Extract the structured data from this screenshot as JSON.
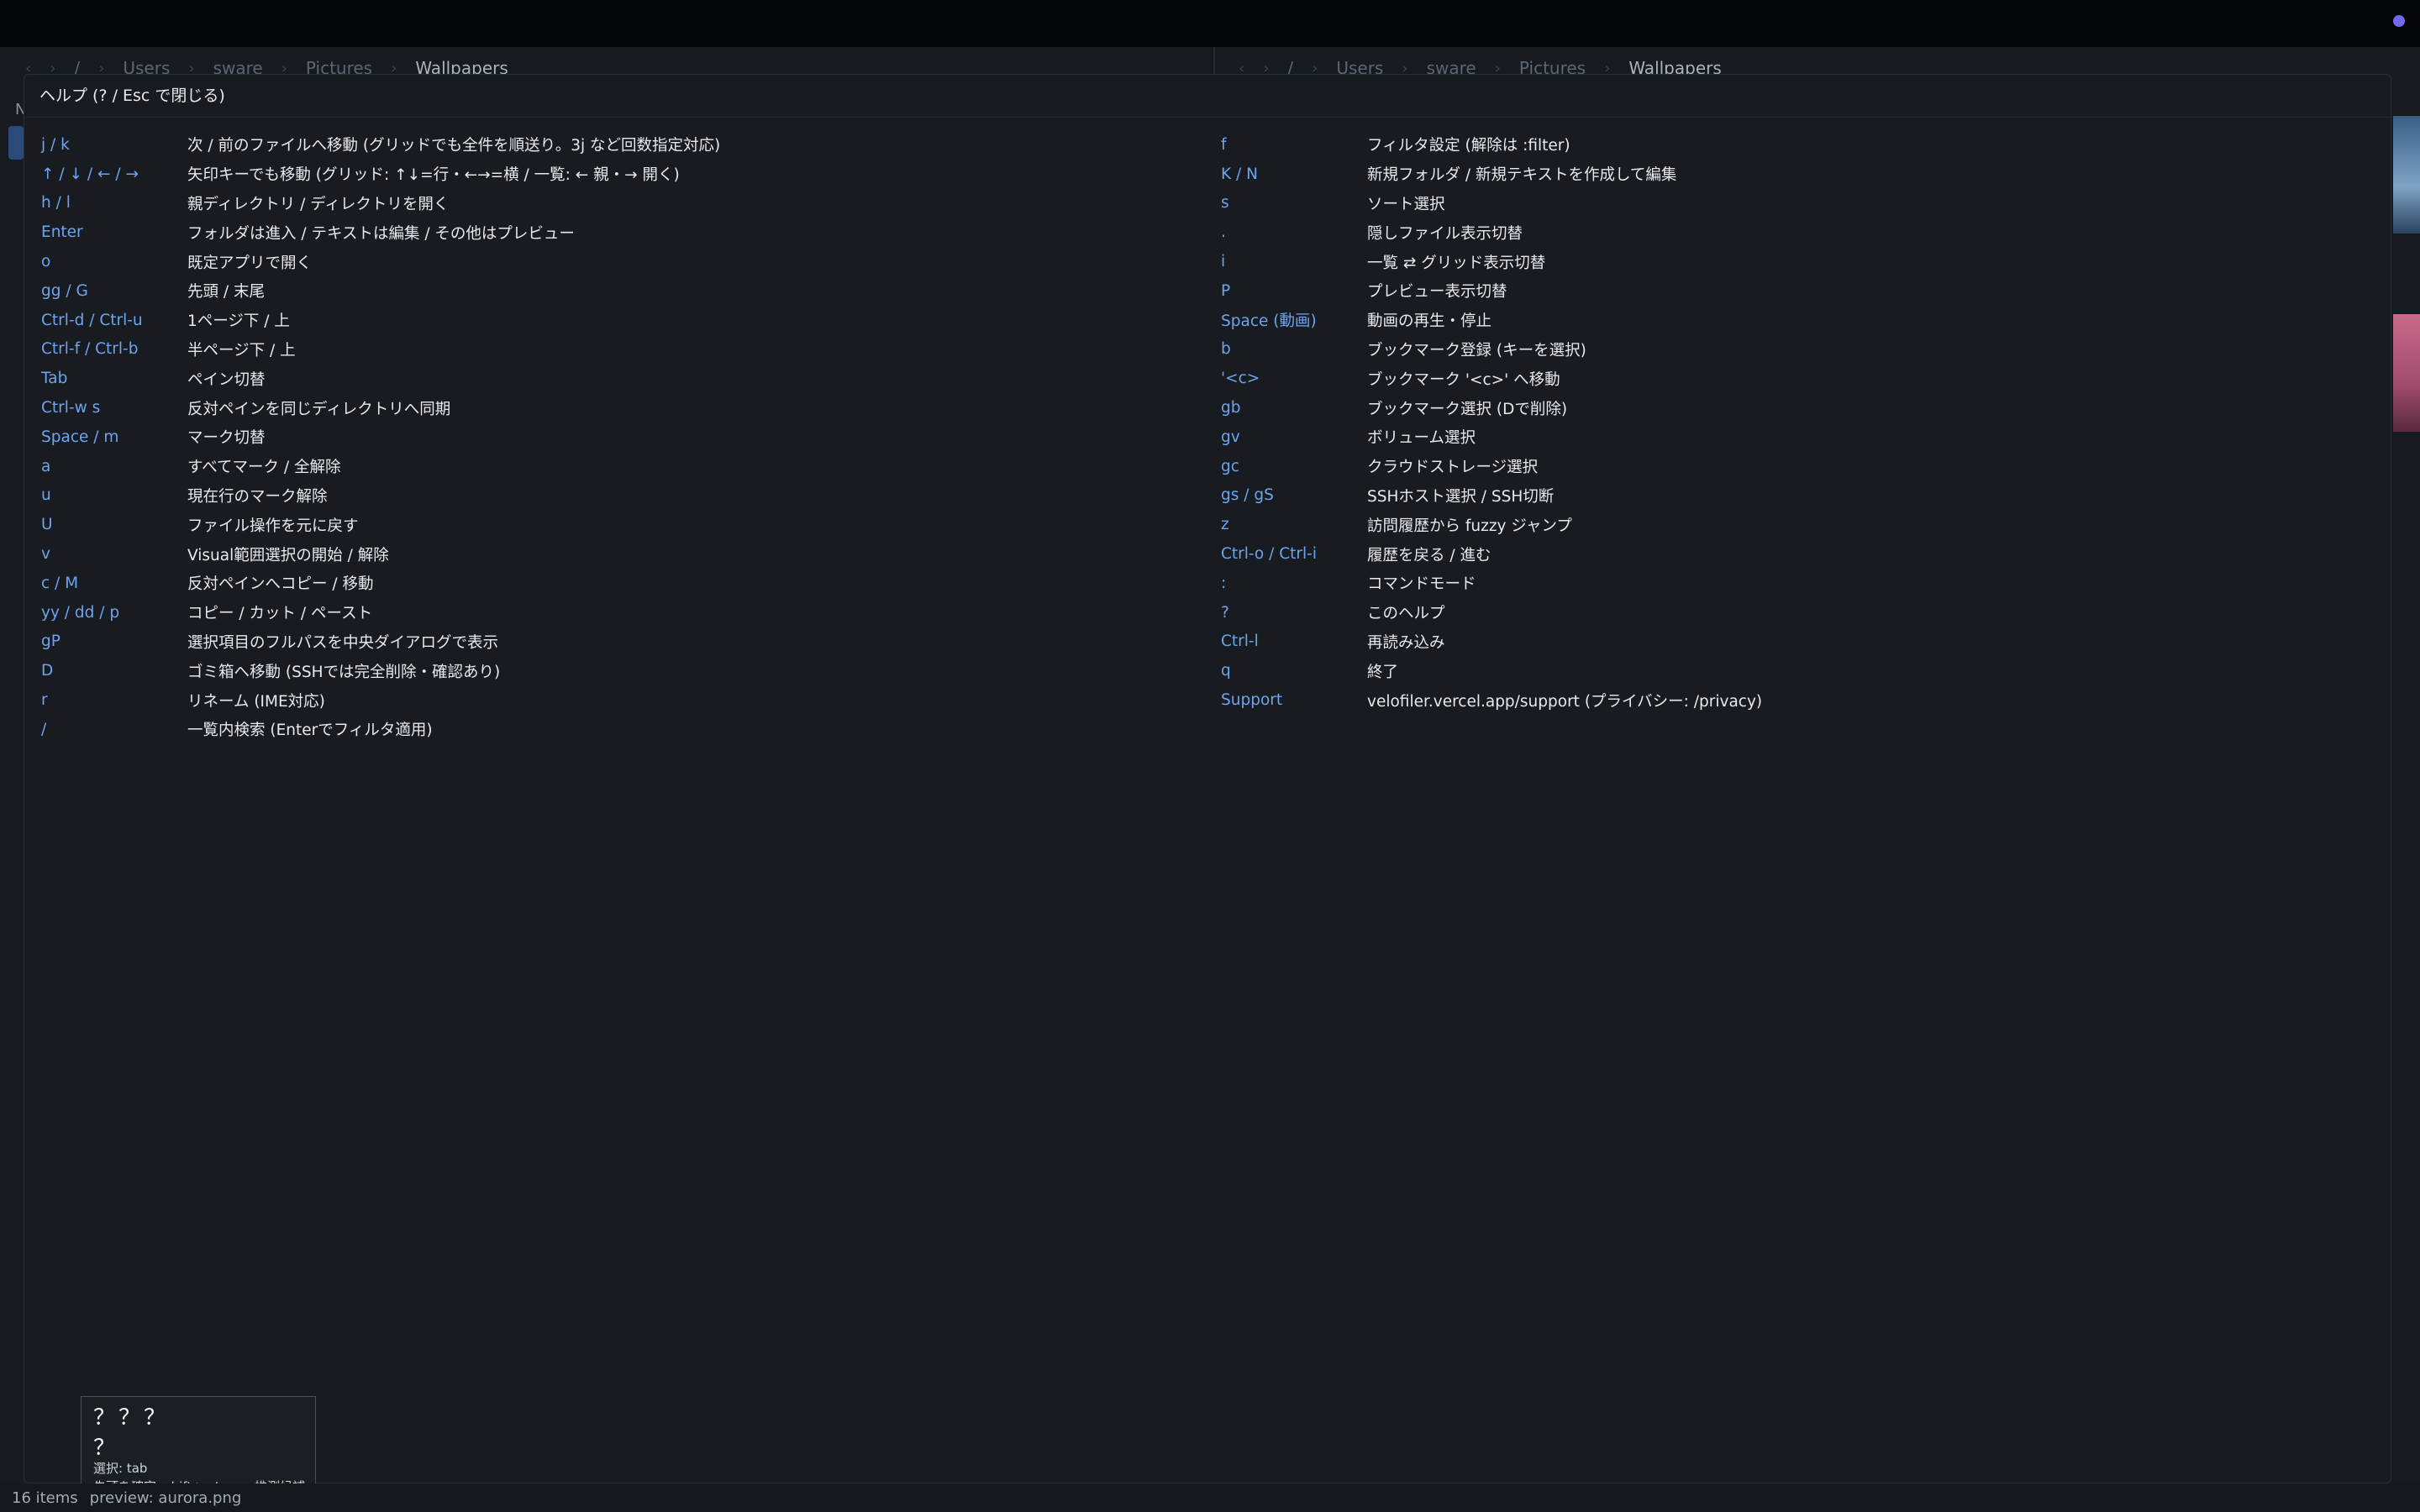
{
  "colors": {
    "accent": "#6da4f0",
    "rec_dot": "#7467f0",
    "background": "#161a1f"
  },
  "left_pane": {
    "breadcrumb": [
      "/",
      "Users",
      "sware",
      "Pictures",
      "Wallpapers"
    ],
    "edge_label": "N"
  },
  "right_pane": {
    "breadcrumb": [
      "/",
      "Users",
      "sware",
      "Pictures",
      "Wallpapers"
    ]
  },
  "help": {
    "title": "ヘルプ (? / Esc で閉じる)",
    "left": [
      {
        "key": "j / k",
        "desc": "次 / 前のファイルへ移動 (グリッドでも全件を順送り。3j など回数指定対応)"
      },
      {
        "key": "↑ / ↓ / ← / →",
        "desc": "矢印キーでも移動 (グリッド: ↑↓=行・←→=横 / 一覧: ← 親・→ 開く)"
      },
      {
        "key": "h / l",
        "desc": "親ディレクトリ / ディレクトリを開く"
      },
      {
        "key": "Enter",
        "desc": "フォルダは進入 / テキストは編集 / その他はプレビュー"
      },
      {
        "key": "o",
        "desc": "既定アプリで開く"
      },
      {
        "key": "gg / G",
        "desc": "先頭 / 末尾"
      },
      {
        "key": "Ctrl-d / Ctrl-u",
        "desc": "1ページ下 / 上"
      },
      {
        "key": "Ctrl-f / Ctrl-b",
        "desc": "半ページ下 / 上"
      },
      {
        "key": "Tab",
        "desc": "ペイン切替"
      },
      {
        "key": "Ctrl-w s",
        "desc": "反対ペインを同じディレクトリへ同期"
      },
      {
        "key": "Space / m",
        "desc": "マーク切替"
      },
      {
        "key": "a",
        "desc": "すべてマーク / 全解除"
      },
      {
        "key": "u",
        "desc": "現在行のマーク解除"
      },
      {
        "key": "U",
        "desc": "ファイル操作を元に戻す"
      },
      {
        "key": "v",
        "desc": "Visual範囲選択の開始 / 解除"
      },
      {
        "key": "c / M",
        "desc": "反対ペインへコピー / 移動"
      },
      {
        "key": "yy / dd / p",
        "desc": "コピー / カット / ペースト"
      },
      {
        "key": "gP",
        "desc": "選択項目のフルパスを中央ダイアログで表示"
      },
      {
        "key": "D",
        "desc": "ゴミ箱へ移動 (SSHでは完全削除・確認あり)"
      },
      {
        "key": "r",
        "desc": "リネーム (IME対応)"
      },
      {
        "key": "/",
        "desc": "一覧内検索 (Enterでフィルタ適用)"
      }
    ],
    "right": [
      {
        "key": "f",
        "desc": "フィルタ設定 (解除は :filter)"
      },
      {
        "key": "K / N",
        "desc": "新規フォルダ / 新規テキストを作成して編集"
      },
      {
        "key": "s",
        "desc": "ソート選択"
      },
      {
        "key": ".",
        "desc": "隠しファイル表示切替"
      },
      {
        "key": "i",
        "desc": "一覧 ⇄ グリッド表示切替"
      },
      {
        "key": "P",
        "desc": "プレビュー表示切替"
      },
      {
        "key": "Space (動画)",
        "desc": "動画の再生・停止"
      },
      {
        "key": "b",
        "desc": "ブックマーク登録 (キーを選択)"
      },
      {
        "key": "'<c>",
        "desc": "ブックマーク '<c>' へ移動"
      },
      {
        "key": "gb",
        "desc": "ブックマーク選択 (Dで削除)"
      },
      {
        "key": "gv",
        "desc": "ボリューム選択"
      },
      {
        "key": "gc",
        "desc": "クラウドストレージ選択"
      },
      {
        "key": "gs / gS",
        "desc": "SSHホスト選択 / SSH切断"
      },
      {
        "key": "z",
        "desc": "訪問履歴から fuzzy ジャンプ"
      },
      {
        "key": "Ctrl-o / Ctrl-i",
        "desc": "履歴を戻る / 進む"
      },
      {
        "key": ":",
        "desc": "コマンドモード"
      },
      {
        "key": "?",
        "desc": "このヘルプ"
      },
      {
        "key": "Ctrl-l",
        "desc": "再読み込み"
      },
      {
        "key": "q",
        "desc": "終了"
      },
      {
        "key": "Support",
        "desc": "velofiler.vercel.app/support (プライバシー: /privacy)"
      }
    ]
  },
  "ime": {
    "composing": "？？？",
    "candidate": "？",
    "hint_select": "選択: tab",
    "hint_confirm": "先頭を確定: shift+return",
    "hint_predict": "推測候補"
  },
  "status": {
    "items": "16 items",
    "preview": "preview: aurora.png"
  }
}
